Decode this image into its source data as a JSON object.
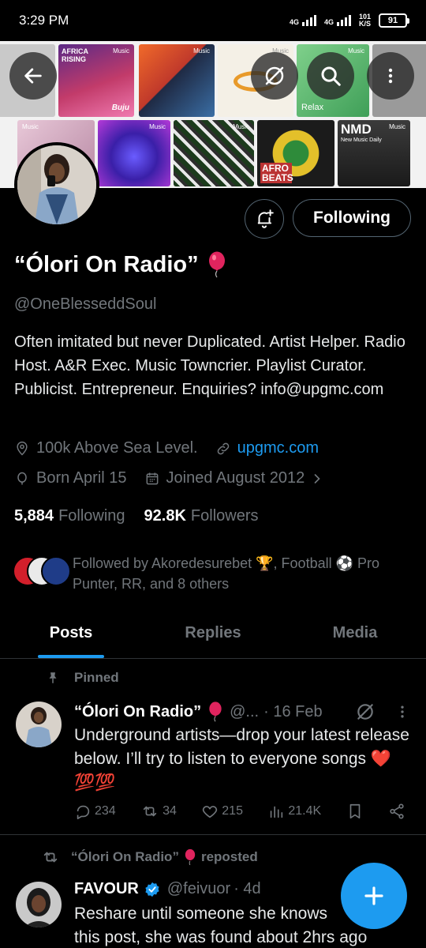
{
  "status_bar": {
    "time": "3:29 PM",
    "network1": "4G",
    "network2": "4G",
    "speed_value": "101",
    "speed_unit": "K/S",
    "battery": "91"
  },
  "banner": {
    "tiles": [
      {
        "label": "AFRICA RISING",
        "tag": "Music"
      },
      {
        "label": "Buju",
        "tag": ""
      },
      {
        "label": "",
        "tag": "Music"
      },
      {
        "label": "",
        "tag": "Music"
      },
      {
        "label": "Relax",
        "tag": "Music"
      },
      {
        "label": "",
        "tag": "Music"
      },
      {
        "label": "",
        "tag": "Music"
      },
      {
        "label": "",
        "tag": "Music"
      },
      {
        "label": "AFRO BEATS",
        "tag": ""
      },
      {
        "label": "NMD",
        "tag": "Music"
      },
      {
        "label": "New Music Daily",
        "tag": ""
      }
    ]
  },
  "profile": {
    "name": "“Ólori On Radio”",
    "handle": "@OneBlesseddSoul",
    "bio": "Often imitated but never Duplicated. Artist Helper. Radio Host. A&R Exec. Music Towncrier. Playlist Curator. Publicist. Entrepreneur. Enquiries? info@upgmc.com",
    "location": "100k Above Sea Level.",
    "website": "upgmc.com",
    "birthday": "Born April 15",
    "joined": "Joined August 2012",
    "following_count": "5,884",
    "following_label": "Following",
    "followers_count": "92.8K",
    "followers_label": "Followers",
    "follow_button": "Following",
    "followed_by": "Followed by Akoredesurebet 🏆, Football ⚽ Pro Punter, RR, and 8 others"
  },
  "tabs": [
    {
      "label": "Posts",
      "active": true
    },
    {
      "label": "Replies",
      "active": false
    },
    {
      "label": "Media",
      "active": false
    }
  ],
  "pinned_post": {
    "pinned_label": "Pinned",
    "author": "“Ólori On Radio”",
    "handle_trunc": "@...",
    "date": "· 16 Feb",
    "text": "Underground artists—drop your latest release below. I’ll try to listen to everyone songs ❤️💯💯",
    "replies": "234",
    "reposts": "34",
    "likes": "215",
    "views": "21.4K"
  },
  "repost": {
    "reposter": "“Ólori On Radio”",
    "reposted_label": "reposted",
    "author": "FAVOUR",
    "handle": "@feivuor",
    "date": "· 4d",
    "text_line1": "Reshare until someone she knows",
    "text_line2": "this post, she was found about 2hrs ago"
  },
  "colors": {
    "accent": "#1d9bf0",
    "background": "#000000",
    "muted": "#71767b",
    "text": "#e7e9ea"
  }
}
